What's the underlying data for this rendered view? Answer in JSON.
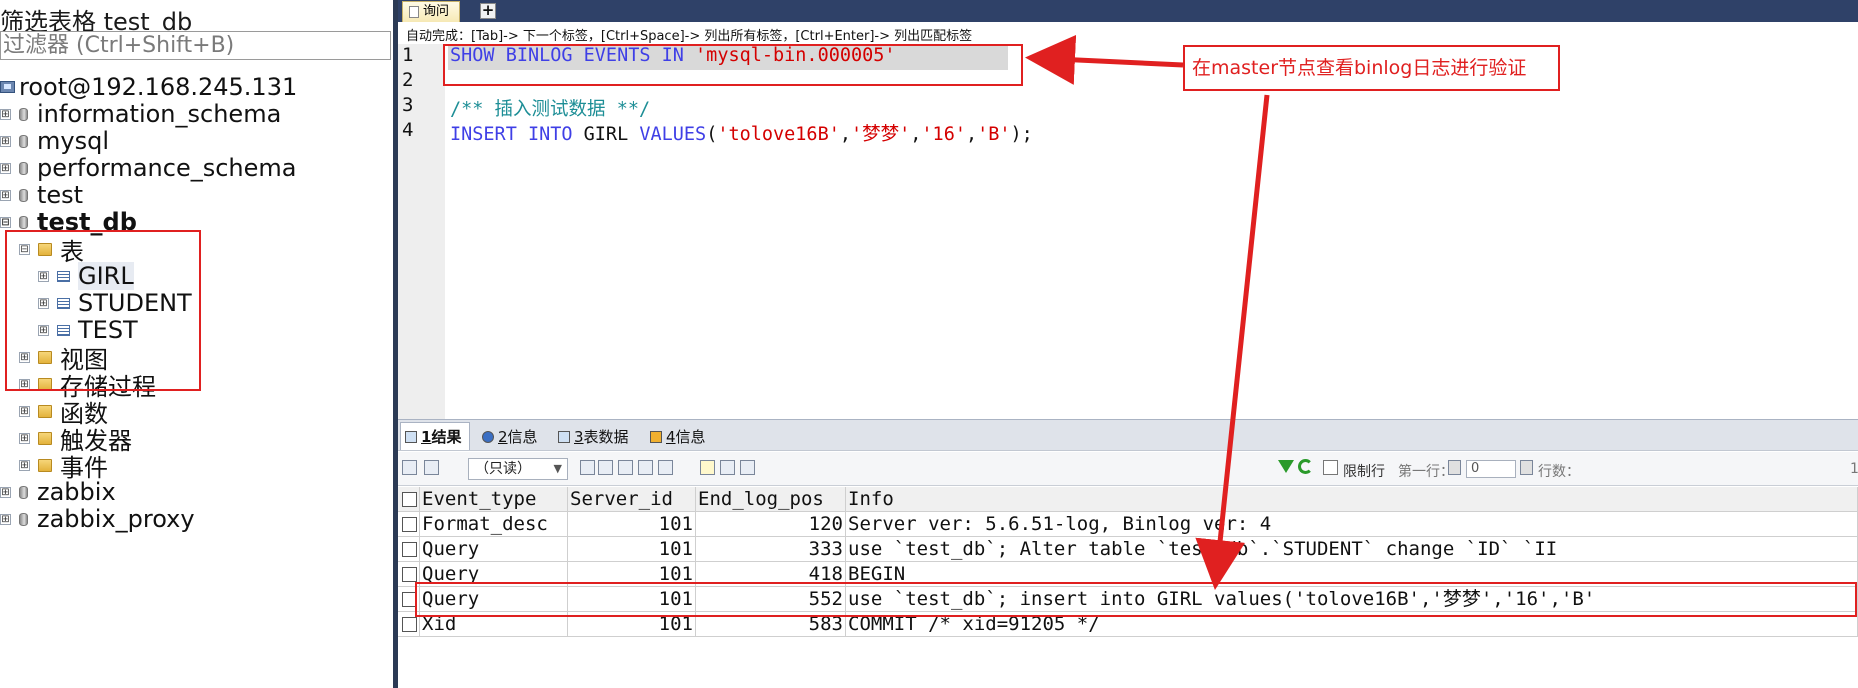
{
  "sidebar": {
    "title": "筛选表格 test_db",
    "filter_placeholder": "过滤器 (Ctrl+Shift+B)",
    "connection": "root@192.168.245.131",
    "databases": [
      "information_schema",
      "mysql",
      "performance_schema",
      "test"
    ],
    "active_db": "test_db",
    "tables_folder": "表",
    "tables": [
      "GIRL",
      "STUDENT",
      "TEST"
    ],
    "folders": [
      "视图",
      "存储过程",
      "函数",
      "触发器",
      "事件"
    ],
    "more_databases": [
      "zabbix",
      "zabbix_proxy"
    ],
    "collapse_glyph": "⊟",
    "expand_glyph": "⊞"
  },
  "editor": {
    "tab_label": "询问",
    "add_tab_label": "+",
    "autocomplete_hint": "自动完成：[Tab]-> 下一个标签，[Ctrl+Space]-> 列出所有标签，[Ctrl+Enter]-> 列出匹配标签",
    "line_numbers": [
      "1",
      "2",
      "3",
      "4"
    ],
    "line1": {
      "kw": "SHOW BINLOG EVENTS IN ",
      "str": "'mysql-bin.000005'"
    },
    "line3": "/** 插入测试数据 **/",
    "line4": {
      "kw1": "INSERT INTO ",
      "table": "GIRL ",
      "kw2": "VALUES",
      "p1": "(",
      "s1": "'tolove16B'",
      "c1": ",",
      "s2": "'梦梦'",
      "c2": ",",
      "s3": "'16'",
      "c3": ",",
      "s4": "'B'",
      "p2": ");"
    }
  },
  "annotation": {
    "callout_text": "在master节点查看binlog日志进行验证"
  },
  "results": {
    "tabs": [
      {
        "num": "1",
        "label": " 结果"
      },
      {
        "num": "2",
        "label": " 信息"
      },
      {
        "num": "3",
        "label": " 表数据"
      },
      {
        "num": "4",
        "label": " 信息"
      }
    ],
    "readonly_label": "（只读）",
    "limit_label": "限制行",
    "first_row_label": "第一行：",
    "first_row_value": "0",
    "rows_label": "行数：",
    "rows_value": "1",
    "columns": [
      "Event_type",
      "Server_id",
      "End_log_pos",
      "Info"
    ],
    "rows": [
      {
        "event_type": "Format_desc",
        "server_id": "101",
        "end_log_pos": "120",
        "info": "Server ver: 5.6.51-log, Binlog ver: 4"
      },
      {
        "event_type": "Query",
        "server_id": "101",
        "end_log_pos": "333",
        "info": "use `test_db`; Alter table `test_db`.`STUDENT`     change `ID` `II"
      },
      {
        "event_type": "Query",
        "server_id": "101",
        "end_log_pos": "418",
        "info": "BEGIN"
      },
      {
        "event_type": "Query",
        "server_id": "101",
        "end_log_pos": "552",
        "info": "use `test_db`; insert into GIRL values('tolove16B','梦梦','16','B'"
      },
      {
        "event_type": "Xid",
        "server_id": "101",
        "end_log_pos": "583",
        "info": "COMMIT /* xid=91205 */"
      }
    ]
  },
  "colors": {
    "annotation_red": "#e02020",
    "keyword_blue": "#3f3fe6",
    "string_red": "#d40000",
    "comment_teal": "#1d8e96",
    "tabbar_navy": "#2f4168"
  },
  "icons": [
    "server-icon",
    "database-icon",
    "folder-icon",
    "table-icon",
    "expand-icon",
    "collapse-icon",
    "filter-icon",
    "refresh-icon",
    "checkbox-icon"
  ]
}
